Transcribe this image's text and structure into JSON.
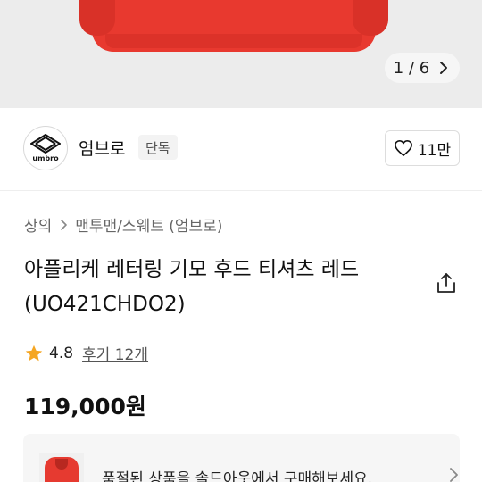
{
  "gallery": {
    "current": 1,
    "total": 6,
    "pager_text": "1 / 6"
  },
  "brand": {
    "name": "엄브로",
    "badge": "단독",
    "logo_text": "umbro"
  },
  "like": {
    "count_text": "11만"
  },
  "breadcrumb": {
    "items": [
      "상의",
      "맨투맨/스웨트 (엄브로)"
    ]
  },
  "product": {
    "title_line1": "아플리케 레터링 기모 후드 티셔츠 레드",
    "title_line2": "(UO421CHDO2)",
    "rating": "4.8",
    "reviews_text": "후기 12개",
    "price": "119,000원"
  },
  "soldout": {
    "message": "품절된 상품을 솔드아웃에서 구매해보세요."
  },
  "colors": {
    "product_red": "#e8392f",
    "star": "#f5a623",
    "hero_bg": "#ececec"
  },
  "icons": {
    "pager_next": "chevron-right-icon",
    "like": "heart-outline-icon",
    "share": "share-icon",
    "rating": "star-icon",
    "breadcrumb_sep": "chevron-right-icon"
  }
}
